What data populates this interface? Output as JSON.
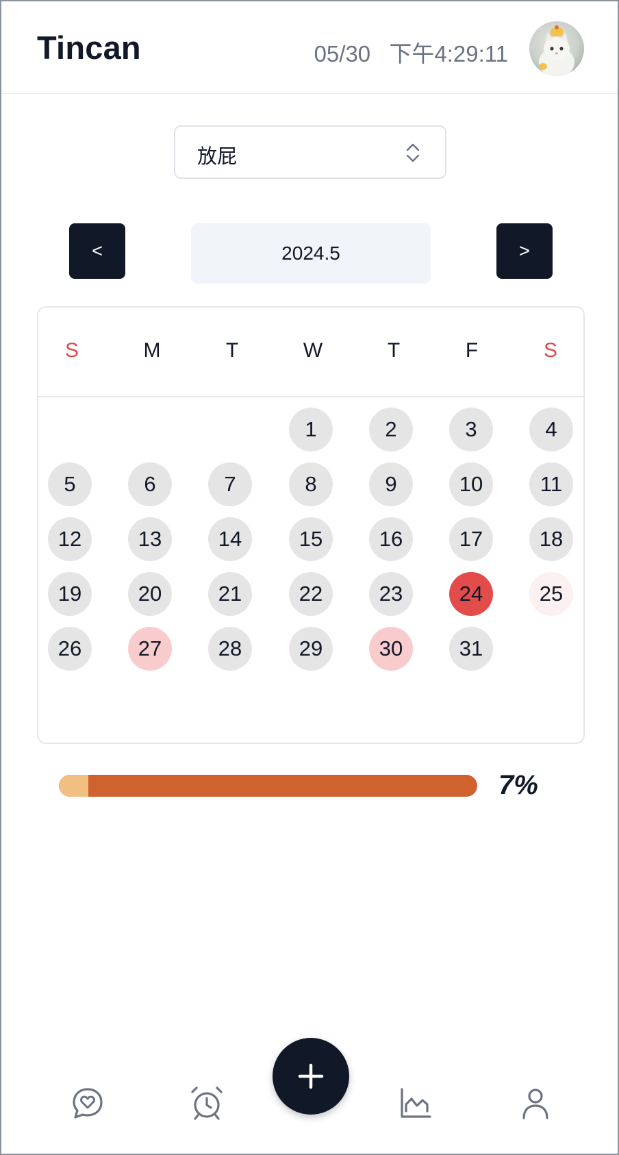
{
  "header": {
    "brand": "Tincan",
    "date": "05/30",
    "time": "下午4:29:11",
    "avatar_icon": "cat-avatar"
  },
  "selector": {
    "value": "放屁",
    "icon": "chevron-up-down-icon"
  },
  "month_nav": {
    "prev_label": "<",
    "next_label": ">",
    "current_month": "2024.5"
  },
  "calendar": {
    "weekdays": [
      "S",
      "M",
      "T",
      "W",
      "T",
      "F",
      "S"
    ],
    "weekend_color": "#dc4c4c",
    "days": [
      "1",
      "2",
      "3",
      "4",
      "5",
      "6",
      "7",
      "8",
      "9",
      "10",
      "11",
      "12",
      "13",
      "14",
      "15",
      "16",
      "17",
      "18",
      "19",
      "20",
      "21",
      "22",
      "23",
      "24",
      "25",
      "26",
      "27",
      "28",
      "29",
      "30",
      "31"
    ],
    "first_weekday": 3,
    "highlights": {
      "24": "#e24c4b",
      "25": "#fdf0f0",
      "27": "#f8cccc",
      "30": "#f8cccc"
    }
  },
  "progress": {
    "percent": 7,
    "label": "7%",
    "fill_color": "#f1bf82",
    "track_color": "#cf622f"
  },
  "bottom_nav": {
    "items": [
      {
        "icon": "chat-heart-icon"
      },
      {
        "icon": "alarm-clock-icon"
      },
      {
        "icon": "plus-icon"
      },
      {
        "icon": "chart-icon"
      },
      {
        "icon": "user-icon"
      }
    ]
  }
}
